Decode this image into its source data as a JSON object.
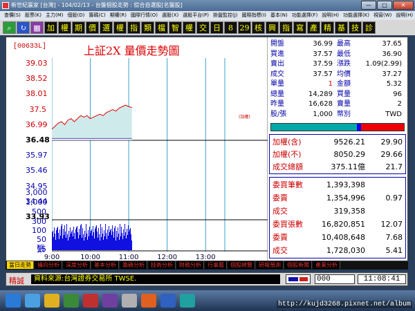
{
  "window": {
    "title": "新世紀贏家 [台灣] - 104/02/13 - 台盤個股走勢 : 綜合自選股[名盤股]",
    "controls": [
      "—",
      "□",
      "✕"
    ]
  },
  "menu": [
    "查價(S)",
    "股票(K)",
    "主力(M)",
    "個股(D)",
    "籌碼(C)",
    "期權(R)",
    "國際行情(O)",
    "選股(X)",
    "選股平台(P)",
    "掛盤監控(J)",
    "國際指標(I)",
    "基本(N)",
    "功能選擇(F)",
    "說明(H)",
    "功能選擇(K)",
    "視窗(W)",
    "說明(H)"
  ],
  "toolbar": [
    "加",
    "權",
    "期",
    "價",
    "選",
    "權",
    "指",
    "類",
    "檔",
    "智",
    "權",
    "交",
    "日",
    "8",
    "29",
    "核",
    "興",
    "指",
    "寫",
    "產",
    "精",
    "基",
    "技",
    "診"
  ],
  "chart": {
    "code": "[00633L]",
    "title": "上証2X  量價走勢圖",
    "ref_note": "(加權)",
    "volume_unit": "張",
    "colors": {
      "price_line": "#dd0000",
      "fill": "#cfeaea",
      "ref_line": "#8844cc",
      "volume": "#1010e0",
      "grid": "#3aa0c8"
    }
  },
  "chart_data": {
    "type": "line",
    "title": "上証2X  量價走勢圖",
    "x_ticks": [
      "9:00",
      "10:00",
      "11:00",
      "12:00",
      "13:00"
    ],
    "price_ticks": [
      39.03,
      38.52,
      38.01,
      37.5,
      36.99,
      36.48,
      35.97,
      35.46,
      34.95,
      34.44,
      33.93
    ],
    "price_highlight": [
      36.48,
      33.93
    ],
    "ylim": [
      33.93,
      39.03
    ],
    "reference_price": 36.48,
    "volume_ticks": [
      "3,000",
      "1,000",
      "500",
      "300",
      "100",
      "50",
      "15"
    ],
    "series": [
      {
        "x": [
          "9:00",
          "9:05",
          "9:10",
          "9:15",
          "9:20",
          "9:25",
          "9:30",
          "9:35",
          "9:40",
          "9:45",
          "9:50",
          "9:55",
          "10:00",
          "10:05",
          "10:10",
          "10:15",
          "10:20",
          "10:25",
          "10:30",
          "10:35",
          "10:40",
          "10:45",
          "10:50",
          "10:55",
          "11:00",
          "11:05"
        ],
        "values": [
          36.85,
          36.95,
          37.05,
          37.1,
          37.0,
          37.15,
          37.2,
          37.1,
          37.2,
          37.3,
          37.25,
          37.3,
          37.2,
          37.25,
          37.3,
          37.35,
          37.3,
          37.4,
          37.45,
          37.5,
          37.45,
          37.55,
          37.6,
          37.65,
          37.6,
          37.57
        ]
      }
    ]
  },
  "quote": {
    "rows": [
      {
        "k1": "開盤",
        "v1": "36.99",
        "k2": "最高",
        "v2": "37.65"
      },
      {
        "k1": "買進",
        "v1": "37.57",
        "k2": "最低",
        "v2": "36.90"
      },
      {
        "k1": "賣出",
        "v1": "37.59",
        "k2": "漲跌",
        "v2": "1.09(2.99)"
      },
      {
        "k1": "成交",
        "v1": "37.57",
        "k2": "均價",
        "v2": "37.27"
      },
      {
        "k1": "單量",
        "v1": "1",
        "k2": "金額",
        "v2": "5.32"
      },
      {
        "k1": "總量",
        "v1": "14,289",
        "k2": "買量",
        "v2": "96"
      },
      {
        "k1": "昨量",
        "v1": "16,628",
        "k2": "賣量",
        "v2": "2"
      },
      {
        "k1": "股/張",
        "v1": "1,000",
        "k2": "幣別",
        "v2": "TWD"
      }
    ],
    "index_box": [
      {
        "k": "加權(含)",
        "v": "9526.21",
        "c": "29.90"
      },
      {
        "k": "加權(不)",
        "v": "8050.29",
        "c": "29.66"
      },
      {
        "k": "成交總額",
        "v": "375.11億",
        "c": "21.7"
      }
    ],
    "order_box": [
      {
        "k": "委買筆數",
        "v": "1,393,398",
        "c": ""
      },
      {
        "k": "委賣",
        "v": "1,354,996",
        "c": "0.97"
      },
      {
        "k": "成交",
        "v": "319,358",
        "c": ""
      },
      {
        "k": "委買張數",
        "v": "16,820,851",
        "c": "12.07"
      },
      {
        "k": "委賣",
        "v": "10,408,648",
        "c": "7.68"
      },
      {
        "k": "成交",
        "v": "1,728,030",
        "c": "5.41"
      }
    ]
  },
  "tabs": [
    "當日走勢",
    "橫向分析",
    "深度分析",
    "基本分析",
    "籌碼分析",
    "技術分析",
    "財務分析",
    "行事曆",
    "個股總覽",
    "研報預測",
    "個股新聞",
    "產業分析"
  ],
  "status": {
    "label": "精誠",
    "source": "資料來源:台灣證券交易所 TWSE.",
    "code": "000",
    "time": "11:08:41"
  },
  "watermark": "http://kujd3268.pixnet.net/album"
}
